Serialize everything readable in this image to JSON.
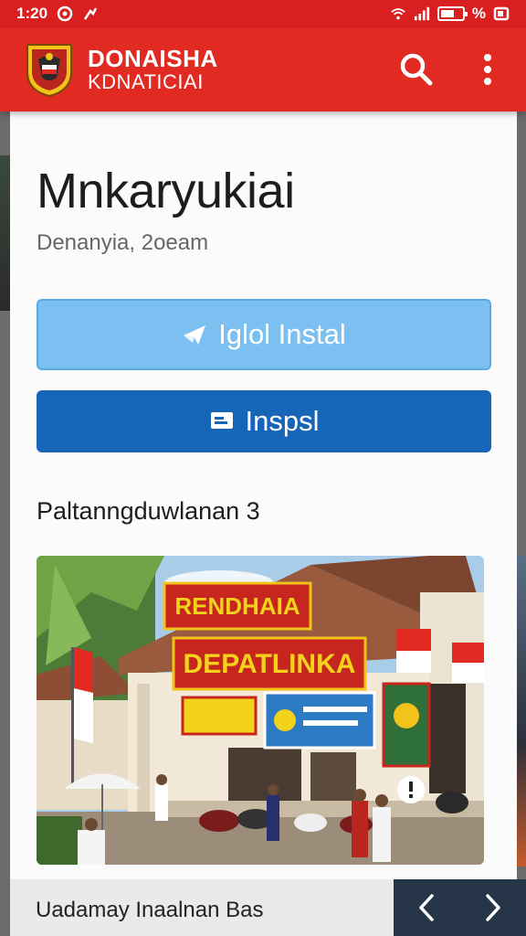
{
  "status_bar": {
    "time": "1:20",
    "battery_text": "%",
    "battery_level": 0.7
  },
  "app_bar": {
    "brand_line1": "DONAISHA",
    "brand_line2": "KDNATICIAI",
    "search_icon": "search-icon",
    "menu_icon": "more-vert-icon"
  },
  "main": {
    "title": "Mnkaryukiai",
    "subtitle": "Denanyia, 2oeam",
    "primary_button": {
      "label": "Iglol Instal",
      "icon": "send-icon"
    },
    "secondary_button": {
      "label": "Inspsl",
      "icon": "screen-icon"
    },
    "section_title": "Paltanngduwlanan 3",
    "photo": {
      "sign_top": "RENDHAIA",
      "sign_main": "DEPATLINKA",
      "banner_left": "",
      "banner_blue": ""
    }
  },
  "bottom_bar": {
    "label": "Uadamay Inaalnan Bas",
    "prev_icon": "chevron-left-icon",
    "next_icon": "chevron-right-icon"
  },
  "colors": {
    "app_bar": "#e02a22",
    "primary_button": "#7cc0f1",
    "secondary_button": "#1765b9",
    "nav_box": "#263547"
  }
}
